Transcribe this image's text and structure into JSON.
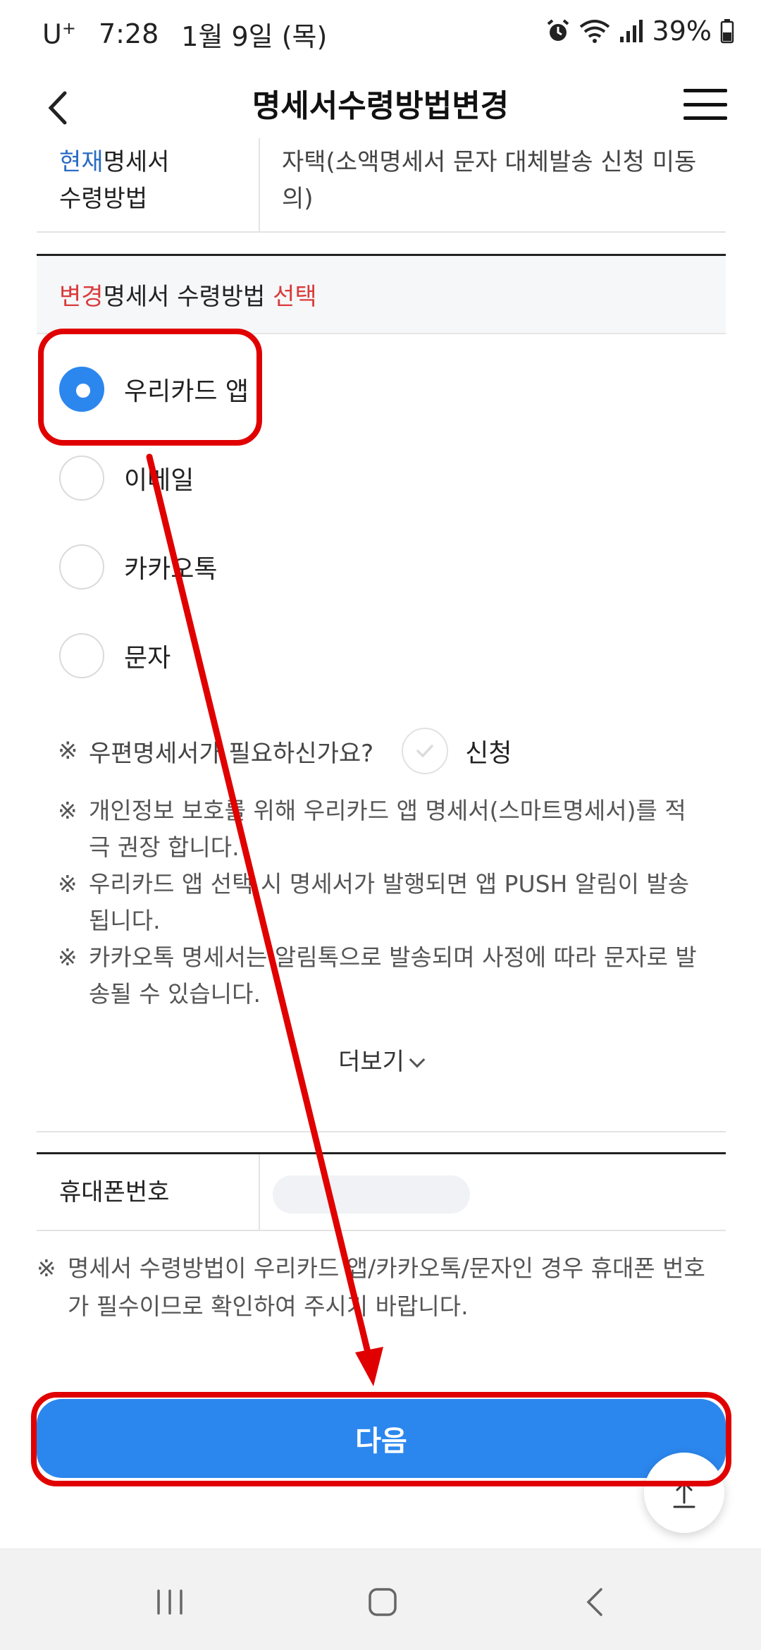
{
  "status_bar": {
    "carrier": "U",
    "carrier_super": "+",
    "time": "7:28",
    "date": "1월 9일 (목)",
    "battery": "39%"
  },
  "header": {
    "title": "명세서수령방법변경"
  },
  "current": {
    "label_highlight": "현재",
    "label_rest1": "명세서",
    "label_line2": "수령방법",
    "value": "자택(소액명세서 문자 대체발송 신청 미동의)"
  },
  "section": {
    "highlight1": "변경",
    "middle": "명세서 수령방법 ",
    "highlight2": "선택"
  },
  "options": [
    {
      "label": "우리카드 앱",
      "checked": true
    },
    {
      "label": "이메일",
      "checked": false
    },
    {
      "label": "카카오톡",
      "checked": false
    },
    {
      "label": "문자",
      "checked": false
    }
  ],
  "postal": {
    "mark": "※",
    "question": "우편명세서가 필요하신가요?",
    "apply_label": "신청"
  },
  "notes": [
    "개인정보 보호를 위해 우리카드 앱 명세서(스마트명세서)를 적극 권장 합니다.",
    "우리카드 앱 선택 시 명세서가 발행되면 앱 PUSH 알림이 발송됩니다.",
    "카카오톡 명세서는 알림톡으로 발송되며 사정에 따라 문자로 발송될 수 있습니다."
  ],
  "more_label": "더보기",
  "phone": {
    "label": "휴대폰번호",
    "note": "명세서 수령방법이 우리카드 앱/카카오톡/문자인 경우 휴대폰 번호가 필수이므로 확인하여 주시기 바랍니다."
  },
  "next_button": "다음",
  "colors": {
    "accent": "#2b87ee",
    "highlight_red": "#d93b3b",
    "highlight_blue": "#2b6cc4",
    "annotation": "#e00000"
  }
}
